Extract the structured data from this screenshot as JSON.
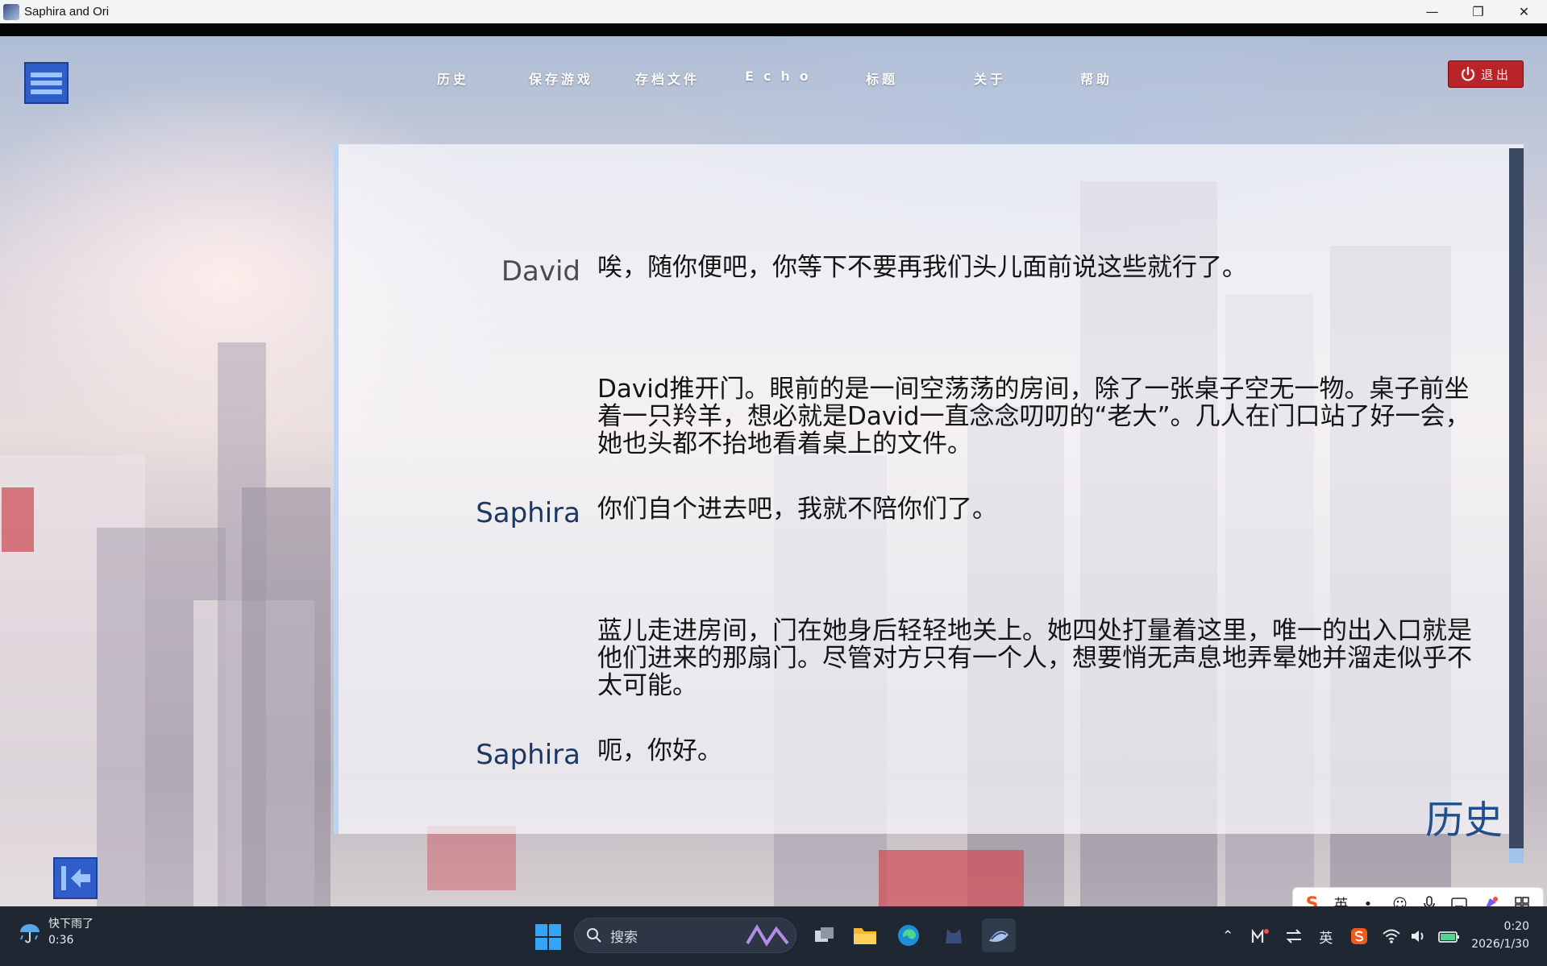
{
  "window": {
    "title": "Saphira and Ori"
  },
  "window_controls": {
    "minimize": "—",
    "restore": "❐",
    "close": "✕"
  },
  "top_nav": {
    "items": [
      "历史",
      "保存游戏",
      "存档文件",
      "Echo",
      "标题",
      "关于",
      "帮助"
    ],
    "quit_label": "退出"
  },
  "history": {
    "title": "历史",
    "entries": [
      {
        "speaker": "David",
        "text": "唉，随你便吧，你等下不要再我们头儿面前说这些就行了。"
      },
      {
        "speaker": "",
        "text": "David推开门。眼前的是一间空荡荡的房间，除了一张桌子空无一物。桌子前坐着一只羚羊，想必就是David一直念念叨叨的“老大”。几人在门口站了好一会，她也头都不抬地看着桌上的文件。"
      },
      {
        "speaker": "Saphira",
        "text": "你们自个进去吧，我就不陪你们了。"
      },
      {
        "speaker": "",
        "text": "蓝儿走进房间，门在她身后轻轻地关上。她四处打量着这里，唯一的出入口就是他们进来的那扇门。尽管对方只有一个人，想要悄无声息地弄晕她并溜走似乎不太可能。"
      },
      {
        "speaker": "Saphira",
        "text": "呃，你好。"
      }
    ]
  },
  "ime": {
    "brand": "S",
    "lang": "英",
    "punct": "•,"
  },
  "taskbar": {
    "weather": {
      "line1": "快下雨了",
      "line2": "0:36"
    },
    "search_placeholder": "搜索",
    "tray_lang": "英",
    "clock": {
      "time": "0:20",
      "date": "2026/1/30"
    }
  },
  "colors": {
    "accent_blue": "#2f5ec8",
    "quit_red": "#b92429",
    "speaker_blue": "#1b3864",
    "speaker_grey": "#4b4b4b",
    "taskbar": "#1f2733"
  }
}
